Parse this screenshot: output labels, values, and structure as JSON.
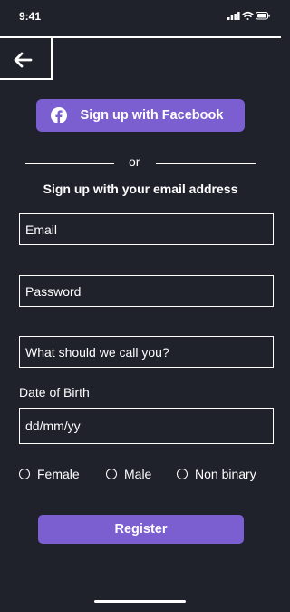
{
  "status_bar": {
    "time": "9:41"
  },
  "facebook_button": {
    "label": "Sign up with Facebook",
    "icon": "facebook-icon"
  },
  "divider": {
    "text": "or"
  },
  "subtitle": "Sign up with your email address",
  "fields": {
    "email": {
      "placeholder": "Email",
      "value": ""
    },
    "password": {
      "placeholder": "Password",
      "value": ""
    },
    "nickname": {
      "placeholder": "What should we call you?",
      "value": ""
    },
    "dob": {
      "label": "Date of Birth",
      "placeholder": "dd/mm/yy",
      "value": ""
    }
  },
  "gender_options": [
    "Female",
    "Male",
    "Non binary"
  ],
  "register_button": {
    "label": "Register"
  },
  "colors": {
    "background": "#1f212b",
    "accent": "#7b5fd0",
    "foreground": "#ffffff"
  }
}
